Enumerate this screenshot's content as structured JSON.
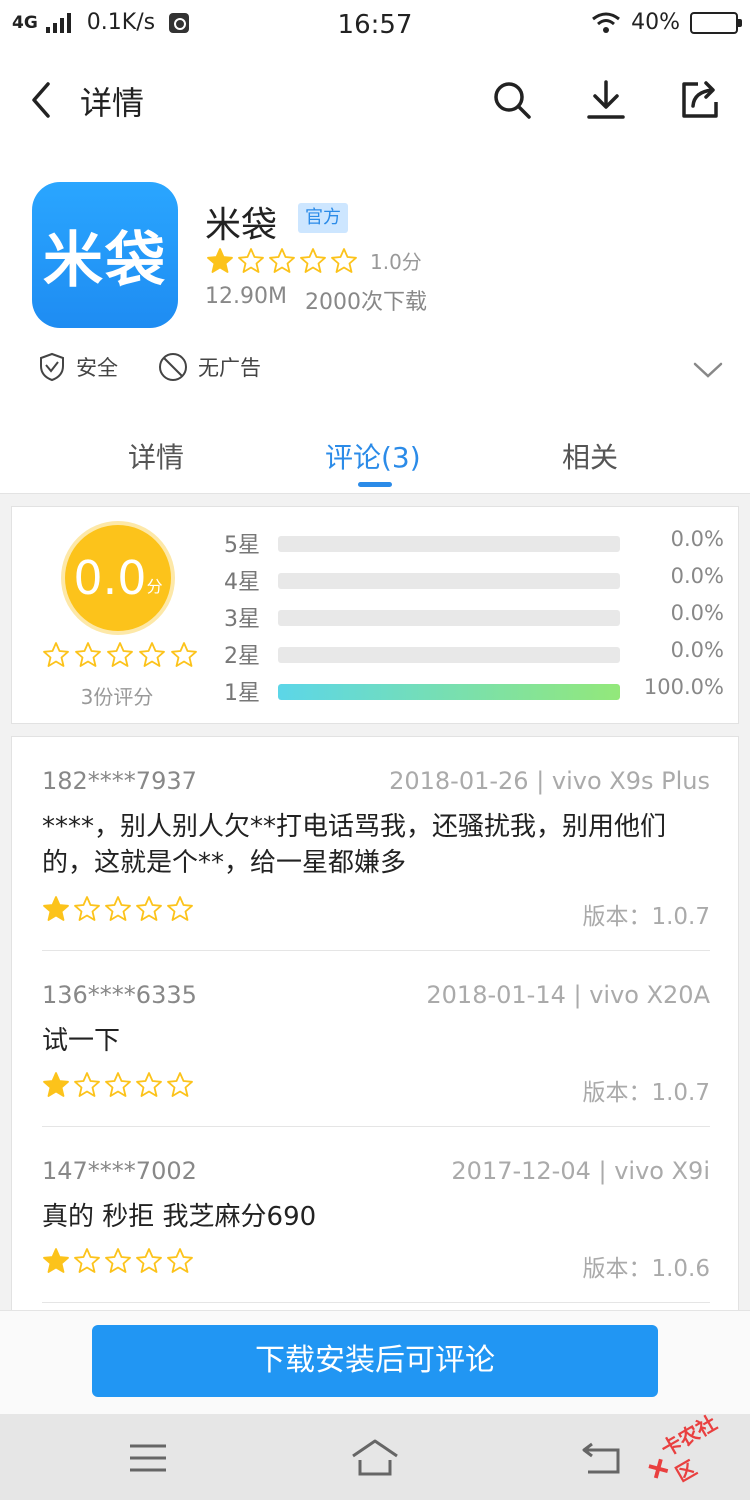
{
  "status_bar": {
    "network": "4G",
    "speed": "0.1K/s",
    "time": "16:57",
    "battery": "40%",
    "battery_level": 0.4
  },
  "header": {
    "title": "详情",
    "icons": [
      "back-icon",
      "search-icon",
      "download-icon",
      "share-icon"
    ]
  },
  "app": {
    "icon_text": "米袋",
    "name": "米袋",
    "badge": "官方",
    "rating_stars": 1,
    "rating_text": "1.0分",
    "size": "12.90M",
    "downloads": "2000次下载",
    "tags": [
      {
        "label": "安全",
        "icon": "shield-check-icon"
      },
      {
        "label": "无广告",
        "icon": "no-ads-icon"
      }
    ]
  },
  "tabs": [
    {
      "label": "详情",
      "active": false
    },
    {
      "label": "评论(3)",
      "active": true
    },
    {
      "label": "相关",
      "active": false
    }
  ],
  "summary": {
    "score": "0.0",
    "score_unit": "分",
    "stars": 0,
    "count": "3份评分",
    "rows": [
      {
        "label": "5星",
        "percent": "0.0%",
        "fraction": 0.0
      },
      {
        "label": "4星",
        "percent": "0.0%",
        "fraction": 0.0
      },
      {
        "label": "3星",
        "percent": "0.0%",
        "fraction": 0.0
      },
      {
        "label": "2星",
        "percent": "0.0%",
        "fraction": 0.0
      },
      {
        "label": "1星",
        "percent": "100.0%",
        "fraction": 1.0
      }
    ]
  },
  "comments": [
    {
      "user": "182****7937",
      "meta": "2018-01-26 | vivo X9s Plus",
      "body": "****，别人别人欠**打电话骂我，还骚扰我，别用他们的，这就是个**，给一星都嫌多",
      "stars": 1,
      "version": "版本：1.0.7"
    },
    {
      "user": "136****6335",
      "meta": "2018-01-14 | vivo X20A",
      "body": "试一下",
      "stars": 1,
      "version": "版本：1.0.7"
    },
    {
      "user": "147****7002",
      "meta": "2017-12-04 | vivo X9i",
      "body": "真的 秒拒  我芝麻分690",
      "stars": 1,
      "version": "版本：1.0.6"
    }
  ],
  "cta": "下载安装后可评论",
  "watermark": "卡农社区",
  "colors": {
    "accent": "#2b8be8",
    "star": "#fcc31b",
    "button": "#2196f3"
  }
}
